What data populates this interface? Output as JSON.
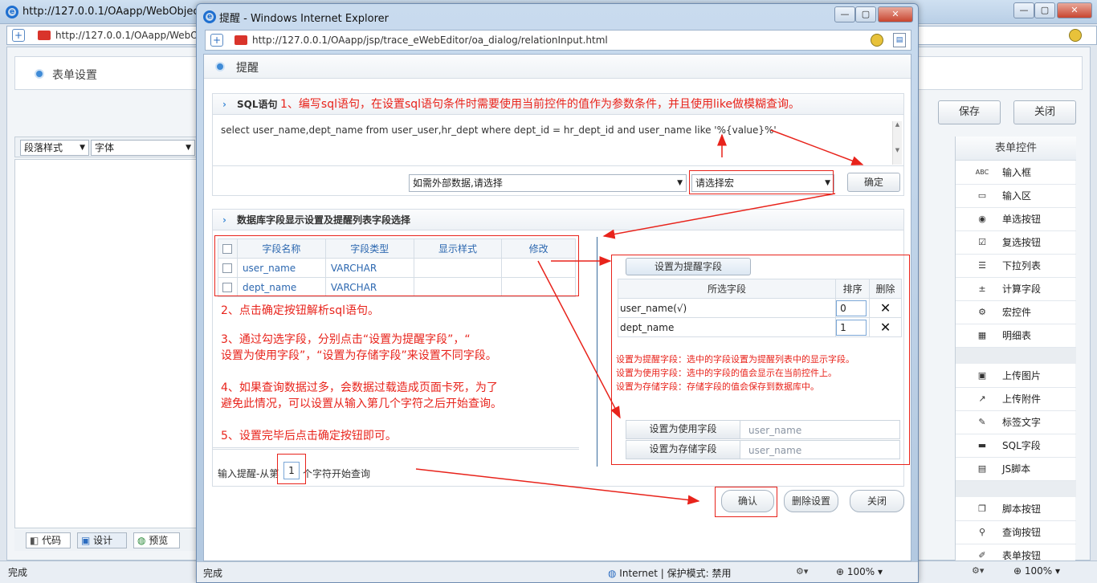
{
  "bg_window": {
    "title": "http://127.0.0.1/OAapp/WebObjects/",
    "address": "http://127.0.0.1/OAapp/WebO",
    "panel_title": "表单设置",
    "buttons": {
      "save": "保存",
      "close": "关闭"
    },
    "editor": {
      "paragraph_style": "段落样式",
      "font": "字体"
    },
    "tabs": {
      "code": "代码",
      "design": "设计",
      "preview": "预览"
    },
    "right_panel": {
      "title": "表单控件",
      "items": [
        {
          "label": "输入框",
          "icon": "text-input-icon",
          "glyph": "ABC"
        },
        {
          "label": "输入区",
          "icon": "textarea-icon",
          "glyph": "▭"
        },
        {
          "label": "单选按钮",
          "icon": "radio-icon",
          "glyph": "◉"
        },
        {
          "label": "复选按钮",
          "icon": "checkbox-icon",
          "glyph": "☑"
        },
        {
          "label": "下拉列表",
          "icon": "list-icon",
          "glyph": "☰"
        },
        {
          "label": "计算字段",
          "icon": "calc-icon",
          "glyph": "±"
        },
        {
          "label": "宏控件",
          "icon": "gear-icon",
          "glyph": "⚙"
        },
        {
          "label": "明细表",
          "icon": "grid-icon",
          "glyph": "▦"
        },
        {
          "label": "上传图片",
          "icon": "image-upload-icon",
          "glyph": "▣"
        },
        {
          "label": "上传附件",
          "icon": "attachment-icon",
          "glyph": "↗"
        },
        {
          "label": "标签文字",
          "icon": "wand-icon",
          "glyph": "✎"
        },
        {
          "label": "SQL字段",
          "icon": "folder-icon",
          "glyph": "▬"
        },
        {
          "label": "JS脚本",
          "icon": "script-icon",
          "glyph": "▤"
        },
        {
          "label": "脚本按钮",
          "icon": "copy-icon",
          "glyph": "❐"
        },
        {
          "label": "查询按钮",
          "icon": "search-icon",
          "glyph": "⚲"
        },
        {
          "label": "表单按钮",
          "icon": "pen-icon",
          "glyph": "✐"
        }
      ]
    },
    "status": {
      "left": "完成",
      "zoom": "100%"
    }
  },
  "dialog": {
    "title": "提醒 - Windows Internet Explorer",
    "address": "http://127.0.0.1/OAapp/jsp/trace_eWebEditor/oa_dialog/relationInput.html",
    "page_title": "提醒",
    "sql_label": "SQL语句",
    "note1": "1、编写sql语句，在设置sql语句条件时需要使用当前控件的值作为参数条件，并且使用like做模糊查询。",
    "sql_text": "select user_name,dept_name from user_user,hr_dept where dept_id = hr_dept_id and user_name like '%{value}%'",
    "external_data_select": "如需外部数据,请选择",
    "macro_select": "请选择宏",
    "ok_button": "确定",
    "db_section_title": "数据库字段显示设置及提醒列表字段选择",
    "field_table": {
      "headers": [
        "字段名称",
        "字段类型",
        "显示样式",
        "修改"
      ],
      "rows": [
        {
          "name": "user_name",
          "type": "VARCHAR",
          "style": "",
          "edit": ""
        },
        {
          "name": "dept_name",
          "type": "VARCHAR",
          "style": "",
          "edit": ""
        }
      ]
    },
    "note2": "2、点击确定按钮解析sql语句。",
    "note3a": "3、通过勾选字段，分别点击“设置为提醒字段”，“",
    "note3b": "设置为使用字段”，“设置为存储字段”来设置不同字段。",
    "note4a": "4、如果查询数据过多，会数据过载造成页面卡死，为了",
    "note4b": "避免此情况，可以设置从输入第几个字符之后开始查询。",
    "note5": "5、设置完毕后点击确定按钮即可。",
    "set_remind_button": "设置为提醒字段",
    "selected_table": {
      "headers": [
        "所选字段",
        "排序",
        "删除"
      ],
      "rows": [
        {
          "field": "user_name(√)",
          "order": "0"
        },
        {
          "field": "dept_name",
          "order": "1"
        }
      ]
    },
    "hint1": "设置为提醒字段：选中的字段设置为提醒列表中的显示字段。",
    "hint2": "设置为使用字段：选中的字段的值会显示在当前控件上。",
    "hint3": "设置为存储字段：存储字段的值会保存到数据库中。",
    "use_field_button": "设置为使用字段",
    "use_field_value": "user_name",
    "store_field_button": "设置为存储字段",
    "store_field_value": "user_name",
    "input_hint_prefix": "输入提醒-从第",
    "input_hint_value": "1",
    "input_hint_suffix": "个字符开始查询",
    "confirm_button": "确认",
    "delete_button": "删除设置",
    "close_button": "关闭",
    "status_left": "完成",
    "status_zone": "Internet | 保护模式: 禁用",
    "status_zoom": "100%"
  },
  "colors": {
    "annotation_red": "#e8231b",
    "link_blue": "#2d68b0",
    "accent": "#3f8bd7"
  }
}
